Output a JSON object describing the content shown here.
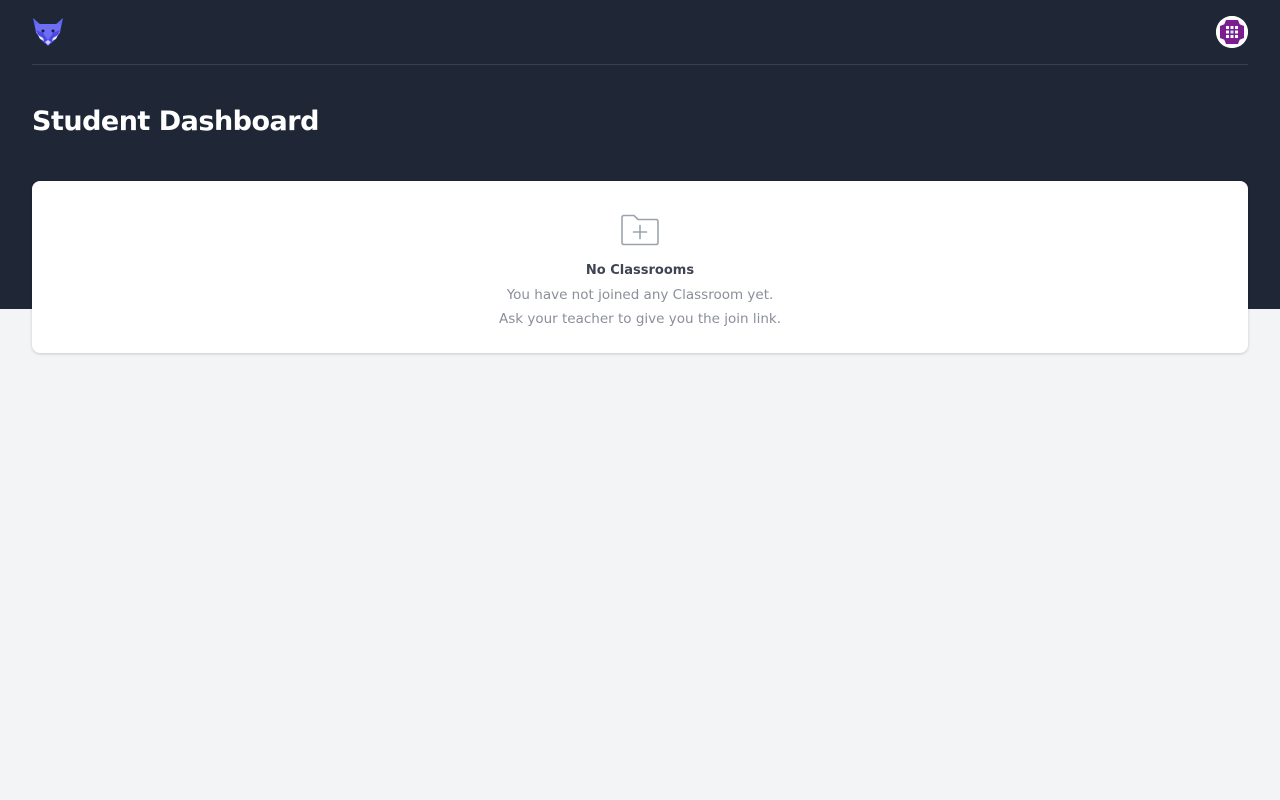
{
  "header": {
    "logo_icon": "fox-logo-icon",
    "avatar_icon": "user-avatar-icon",
    "brand_color": "#6366f1",
    "avatar_color": "#7c1d8f"
  },
  "page": {
    "title": "Student Dashboard"
  },
  "empty_state": {
    "icon": "folder-plus-icon",
    "title": "No Classrooms",
    "line1": "You have not joined any Classroom yet.",
    "line2": "Ask your teacher to give you the join link."
  },
  "colors": {
    "header_bg": "#1f2737",
    "page_bg": "#f3f4f6",
    "card_bg": "#ffffff"
  }
}
